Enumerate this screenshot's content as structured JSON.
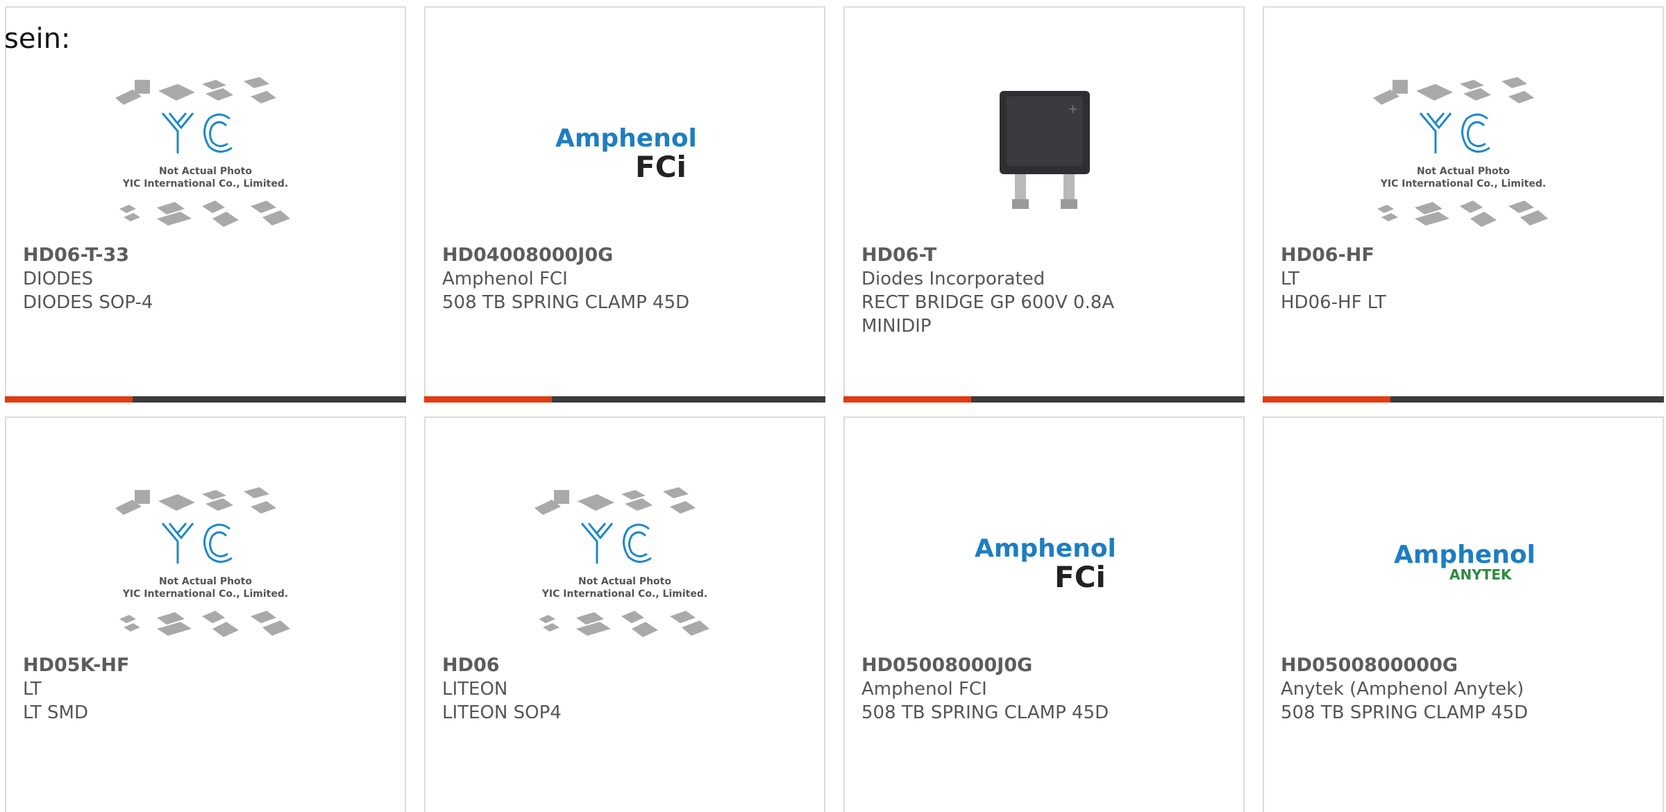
{
  "lead_text": "sein:",
  "colors": {
    "accent": "#e23b12",
    "bar": "#3c3c3c",
    "amphenol_blue": "#1e7dc2",
    "anytek_green": "#2e8b3f",
    "yic_blue": "#1e88c8"
  },
  "placeholder": {
    "line1": "Not Actual Photo",
    "line2": "YIC International Co., Limited.",
    "logo": "YIC"
  },
  "logos": {
    "amphenol": "Amphenol",
    "fci": "FCi",
    "anytek": "ANYTEK"
  },
  "products": [
    {
      "pn": "HD06-T-33",
      "mfr": "DIODES",
      "desc": "DIODES SOP-4",
      "image": "yic-placeholder"
    },
    {
      "pn": "HD04008000J0G",
      "mfr": "Amphenol FCI",
      "desc": "508 TB SPRING CLAMP 45D",
      "image": "amphenol-fci-logo"
    },
    {
      "pn": "HD06-T",
      "mfr": "Diodes Incorporated",
      "desc": "RECT BRIDGE GP 600V 0.8A MINIDIP",
      "image": "chip-photo"
    },
    {
      "pn": "HD06-HF",
      "mfr": "LT",
      "desc": "HD06-HF LT",
      "image": "yic-placeholder"
    },
    {
      "pn": "HD05K-HF",
      "mfr": "LT",
      "desc": "LT SMD",
      "image": "yic-placeholder"
    },
    {
      "pn": "HD06",
      "mfr": "LITEON",
      "desc": "LITEON SOP4",
      "image": "yic-placeholder"
    },
    {
      "pn": "HD05008000J0G",
      "mfr": "Amphenol FCI",
      "desc": "508 TB SPRING CLAMP 45D",
      "image": "amphenol-fci-logo"
    },
    {
      "pn": "HD0500800000G",
      "mfr": "Anytek (Amphenol Anytek)",
      "desc": "508 TB SPRING CLAMP 45D",
      "image": "amphenol-anytek-logo"
    }
  ]
}
